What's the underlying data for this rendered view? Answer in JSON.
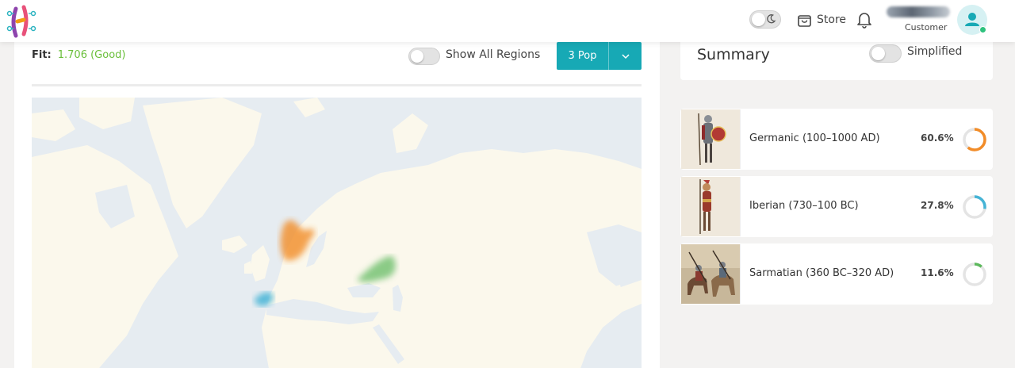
{
  "header": {
    "store_label": "Store",
    "role_label": "Customer",
    "icons": [
      "app-logo-icon",
      "moon-icon",
      "shopping-bag-icon",
      "bell-icon",
      "user-icon"
    ]
  },
  "main": {
    "fit_label": "Fit:",
    "fit_value": "1.706 (Good)",
    "show_all_regions_label": "Show All Regions",
    "show_all_regions_on": false,
    "pop_selector_label": "3 Pop",
    "accent_color": "#17a9b5"
  },
  "summary": {
    "title": "Summary",
    "simplified_label": "Simplified",
    "simplified_on": false
  },
  "populations": [
    {
      "name": "Germanic (100–1000 AD)",
      "percent_text": "60.6%",
      "fraction": 0.606,
      "color": "#f28c28"
    },
    {
      "name": "Iberian (730–100 BC)",
      "percent_text": "27.8%",
      "fraction": 0.278,
      "color": "#45b4d6"
    },
    {
      "name": "Sarmatian (360 BC–320 AD)",
      "percent_text": "11.6%",
      "fraction": 0.116,
      "color": "#5cb85c"
    }
  ]
}
